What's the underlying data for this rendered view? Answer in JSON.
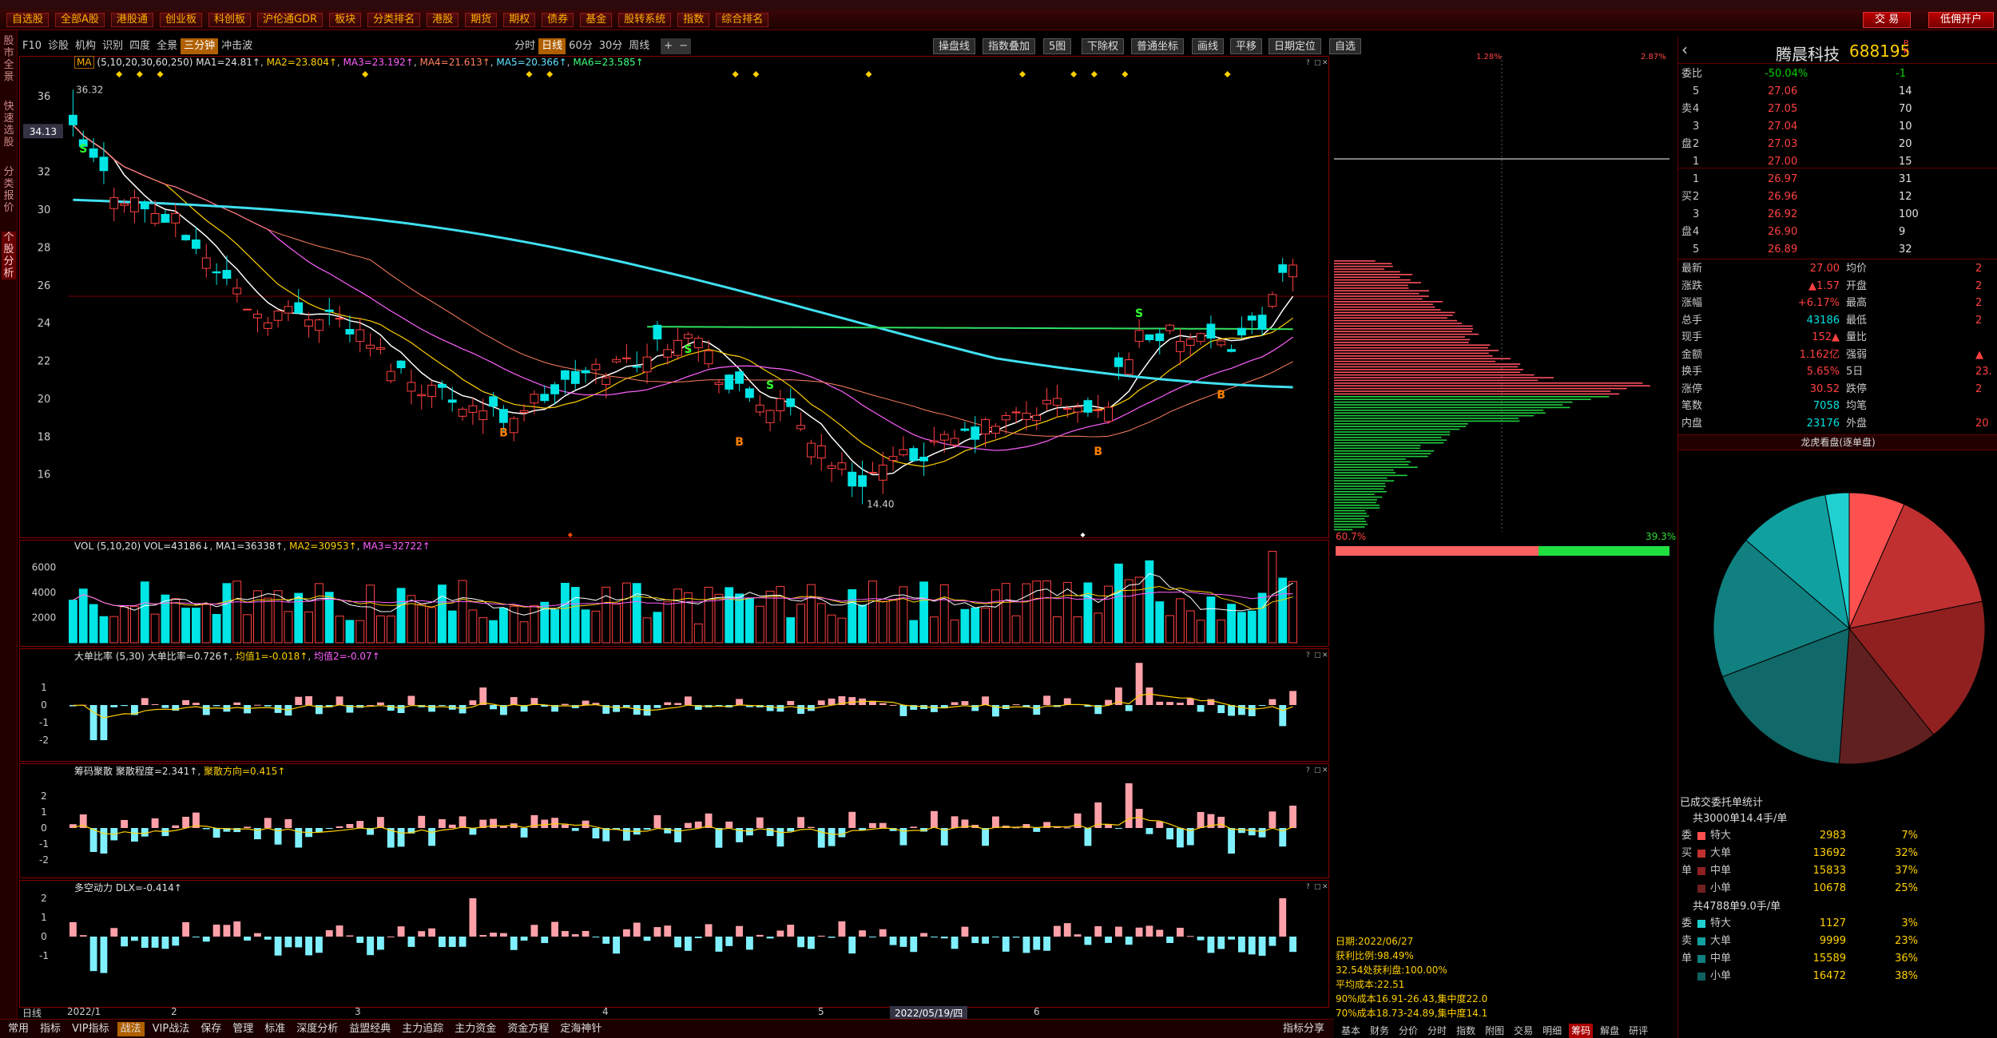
{
  "menu": [
    "自选股",
    "全部A股",
    "港股通",
    "创业板",
    "科创板",
    "沪伦通GDR",
    "板块",
    "分类排名",
    "港股",
    "期货",
    "期权",
    "债券",
    "基金",
    "股转系统",
    "指数",
    "综合排名"
  ],
  "topright": {
    "trade": "交 易",
    "open_acct": "低佣开户"
  },
  "left_tabs": [
    "股市全景",
    "快速选股",
    "分类报价",
    "个股分析"
  ],
  "toolbar": {
    "left": [
      "F10",
      "诊股",
      "机构",
      "识别",
      "四度",
      "全景",
      "三分钟",
      "冲击波"
    ],
    "period": [
      "分时",
      "日线",
      "60分",
      "30分",
      "周线"
    ],
    "active_period": "日线",
    "right": [
      "操盘线",
      "指数叠加",
      "5图",
      "下除权",
      "普通坐标",
      "画线",
      "平移",
      "日期定位",
      "自选"
    ]
  },
  "ma": {
    "label": "MA",
    "params": "(5,10,20,30,60,250)",
    "ma1": "MA1=24.81↑",
    "ma2": "MA2=23.804↑",
    "ma3": "MA3=23.192↑",
    "ma4": "MA4=21.613↑",
    "ma5": "MA5=20.366↑",
    "ma6": "MA6=23.585↑",
    "high_label": "36.32",
    "low_label": "14.40",
    "cursor_price": "34.13"
  },
  "price_axis": [
    "36",
    "34",
    "32",
    "30",
    "28",
    "26",
    "24",
    "22",
    "20",
    "18",
    "16"
  ],
  "vol": {
    "label": "VOL",
    "params": "(5,10,20)",
    "vol": "VOL=43186↓",
    "ma1": "MA1=36338↑",
    "ma2": "MA2=30953↑",
    "ma3": "MA3=32722↑",
    "axis": [
      "6000",
      "4000",
      "2000"
    ]
  },
  "dadan": {
    "label": "大单比率",
    "params": "(5,30)",
    "value": "大单比率=0.726↑",
    "avg1": "均值1=-0.018↑",
    "avg2": "均值2=-0.07↑",
    "axis": [
      "1",
      "0",
      "-1",
      "-2"
    ]
  },
  "chouma": {
    "label": "筹码聚散",
    "degree": "聚散程度=2.341↑",
    "dir": "聚散方向=0.415↑",
    "axis": [
      "2",
      "1",
      "0",
      "-1",
      "-2"
    ]
  },
  "duokong": {
    "label": "多空动力",
    "value": "DLX=-0.414↑",
    "axis": [
      "2",
      "1",
      "0",
      "-1"
    ]
  },
  "xaxis": {
    "labels": [
      "2022/1",
      "2",
      "3",
      "4",
      "5",
      "6"
    ],
    "cursor_date": "2022/05/19/四",
    "start": "日线"
  },
  "bottom_tabs": [
    "常用",
    "指标",
    "VIP指标",
    "战法",
    "VIP战法",
    "保存",
    "管理",
    "标准",
    "深度分析",
    "益盟经典",
    "主力追踪",
    "主力资金",
    "资金方程",
    "定海神针",
    "指标分享"
  ],
  "chip": {
    "top_pct": "1.28%",
    "top_pct2": "2.87%",
    "left_pct": "60.7%",
    "right_pct": "39.3%",
    "info": [
      "日期:2022/06/27",
      "获利比例:98.49%",
      "32.54处获利盘:100.00%",
      "平均成本:22.51",
      "90%成本16.91-26.43,集中度22.0",
      "70%成本18.73-24.89,集中度14.1"
    ],
    "tabs": [
      "基本",
      "财务",
      "分价",
      "分时",
      "指数",
      "附图",
      "交易",
      "明细",
      "筹码",
      "解盘",
      "研评"
    ]
  },
  "stock": {
    "name": "腾晨科技",
    "code": "688195",
    "weibi_label": "委比",
    "weibi": "-50.04%",
    "weicha": "-1"
  },
  "asks": [
    {
      "lvl": "5",
      "price": "27.06",
      "vol": "14"
    },
    {
      "lvl": "4",
      "price": "27.05",
      "vol": "70"
    },
    {
      "lvl": "3",
      "price": "27.04",
      "vol": "10"
    },
    {
      "lvl": "2",
      "price": "27.03",
      "vol": "20"
    },
    {
      "lvl": "1",
      "price": "27.00",
      "vol": "15"
    }
  ],
  "bids": [
    {
      "lvl": "1",
      "price": "26.97",
      "vol": "31"
    },
    {
      "lvl": "2",
      "price": "26.96",
      "vol": "12"
    },
    {
      "lvl": "3",
      "price": "26.92",
      "vol": "100"
    },
    {
      "lvl": "4",
      "price": "26.90",
      "vol": "9"
    },
    {
      "lvl": "5",
      "price": "26.89",
      "vol": "32"
    }
  ],
  "stats": [
    {
      "l": "最新",
      "v": "27.00",
      "l2": "均价",
      "v2": "2"
    },
    {
      "l": "涨跌",
      "v": "▲1.57",
      "l2": "开盘",
      "v2": "2"
    },
    {
      "l": "涨幅",
      "v": "+6.17%",
      "l2": "最高",
      "v2": "2"
    },
    {
      "l": "总手",
      "v": "43186",
      "l2": "最低",
      "v2": "2"
    },
    {
      "l": "现手",
      "v": "152▲",
      "l2": "量比",
      "v2": ""
    },
    {
      "l": "金额",
      "v": "1.162亿",
      "l2": "强弱",
      "v2": "▲"
    },
    {
      "l": "换手",
      "v": "5.65%",
      "l2": "5日",
      "v2": "23."
    },
    {
      "l": "涨停",
      "v": "30.52",
      "l2": "跌停",
      "v2": "2"
    },
    {
      "l": "笔数",
      "v": "7058",
      "l2": "均笔",
      "v2": ""
    },
    {
      "l": "内盘",
      "v": "23176",
      "l2": "外盘",
      "v2": "20"
    }
  ],
  "lhb_title": "龙虎看盘(逐单盘)",
  "orders_title": "已成交委托单统计",
  "buy_summary": "共3000单14.4手/单",
  "buy_rows": [
    {
      "side": "委",
      "name": "特大",
      "v": "2983",
      "p": "7%",
      "color": "#ff5050"
    },
    {
      "side": "买",
      "name": "大单",
      "v": "13692",
      "p": "32%",
      "color": "#c03030"
    },
    {
      "side": "单",
      "name": "中单",
      "v": "15833",
      "p": "37%",
      "color": "#902020"
    },
    {
      "side": "",
      "name": "小单",
      "v": "10678",
      "p": "25%",
      "color": "#702020"
    }
  ],
  "sell_summary": "共4788单9.0手/单",
  "sell_rows": [
    {
      "side": "委",
      "name": "特大",
      "v": "1127",
      "p": "3%",
      "color": "#20d0d0"
    },
    {
      "side": "卖",
      "name": "大单",
      "v": "9999",
      "p": "23%",
      "color": "#10a0a0"
    },
    {
      "side": "单",
      "name": "中单",
      "v": "15589",
      "p": "36%",
      "color": "#108080"
    },
    {
      "side": "",
      "name": "小单",
      "v": "16472",
      "p": "38%",
      "color": "#106060"
    }
  ]
}
